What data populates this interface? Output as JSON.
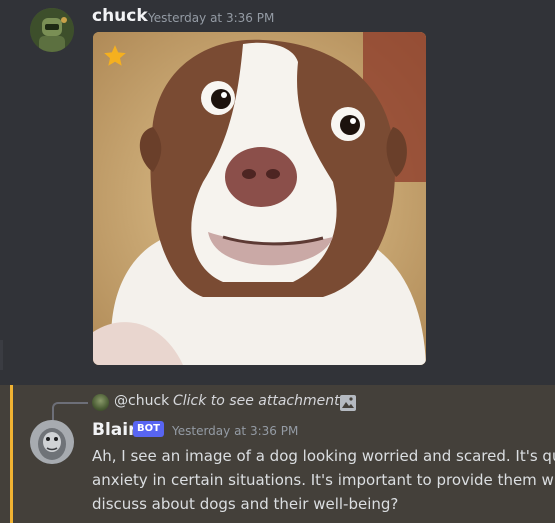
{
  "messages": [
    {
      "author": "chuck",
      "timestamp": "Yesterday at 3:36 PM",
      "attachment": {
        "type": "gif",
        "description_icon": "star-icon"
      }
    },
    {
      "author": "Blair",
      "badge": "BOT",
      "timestamp": "Yesterday at 3:36 PM",
      "reply": {
        "user": "@chuck",
        "text": "Click to see attachment",
        "icon": "image-icon"
      },
      "body_lines": [
        "Ah, I see an image of a dog looking worried and scared. It's qui",
        "anxiety in certain situations. It's important to provide them wi",
        "discuss about dogs and their well-being?"
      ]
    }
  ],
  "colors": {
    "background": "#313338",
    "highlight_background": "#44403a",
    "highlight_bar": "#f0b232",
    "bot_badge": "#5865f2",
    "timestamp": "#949ba4"
  }
}
